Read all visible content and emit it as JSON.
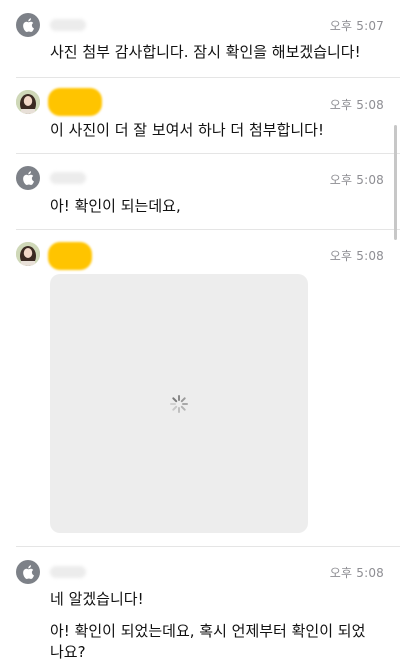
{
  "messages": [
    {
      "sender_type": "apple-avatar",
      "time": "오후 5:07",
      "lines": [
        "사진 첨부 감사합니다. 잠시 확인을 해보겠습니다!"
      ]
    },
    {
      "sender_type": "user-avatar",
      "time": "오후 5:08",
      "lines": [
        "이 사진이 더 잘 보여서 하나 더 첨부합니다!"
      ]
    },
    {
      "sender_type": "apple-avatar",
      "time": "오후 5:08",
      "lines": [
        "아! 확인이 되는데요,"
      ]
    },
    {
      "sender_type": "user-avatar",
      "time": "오후 5:08",
      "attachment": "image-loading"
    },
    {
      "sender_type": "apple-avatar",
      "time": "오후 5:08",
      "lines": [
        "네 알겠습니다!",
        "아! 확인이 되었는데요, 혹시 언제부터 확인이 되었",
        "나요?"
      ]
    }
  ],
  "colors": {
    "redaction": "#ffc400",
    "timestamp": "#8e8e93",
    "divider": "#e5e5e5",
    "image_placeholder": "#ededed"
  },
  "icons": [
    "apple-logo-icon",
    "loading-spinner-icon"
  ]
}
